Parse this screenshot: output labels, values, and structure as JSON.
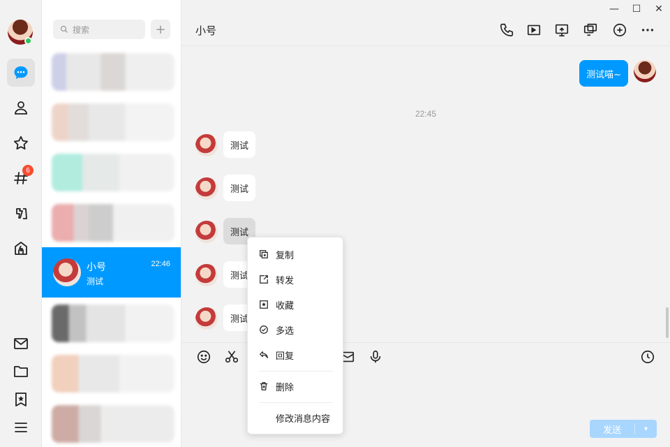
{
  "nav": {
    "badge_count": "6",
    "icons": [
      "chat-icon",
      "contacts-icon",
      "star-icon",
      "channel-icon",
      "games-icon",
      "shop-icon",
      "mail-icon",
      "folder-icon",
      "bookmark-icon",
      "menu-icon"
    ]
  },
  "list": {
    "search_placeholder": "搜索",
    "plus_label": "+",
    "selected": {
      "name": "小号",
      "time": "22:46",
      "last_message": "测试"
    }
  },
  "window": {
    "min": "—",
    "max": "☐",
    "close": "✕"
  },
  "chat": {
    "title": "小号",
    "my_message": "测试喵~",
    "time_separator": "22:45",
    "messages": [
      "测试",
      "测试",
      "测试",
      "测试",
      "测试"
    ]
  },
  "input": {
    "send_label": "发送",
    "send_arrow": "▾"
  },
  "context_menu": {
    "items": [
      {
        "label": "复制",
        "icon": "copy-icon"
      },
      {
        "label": "转发",
        "icon": "forward-icon"
      },
      {
        "label": "收藏",
        "icon": "favorite-icon"
      },
      {
        "label": "多选",
        "icon": "multi-select-icon"
      },
      {
        "label": "回复",
        "icon": "reply-icon"
      },
      {
        "label": "删除",
        "icon": "delete-icon"
      },
      {
        "label": "修改消息内容",
        "icon": ""
      }
    ]
  },
  "colors": {
    "accent": "#0099ff",
    "badge": "#f74c31",
    "online": "#2bc75a"
  }
}
